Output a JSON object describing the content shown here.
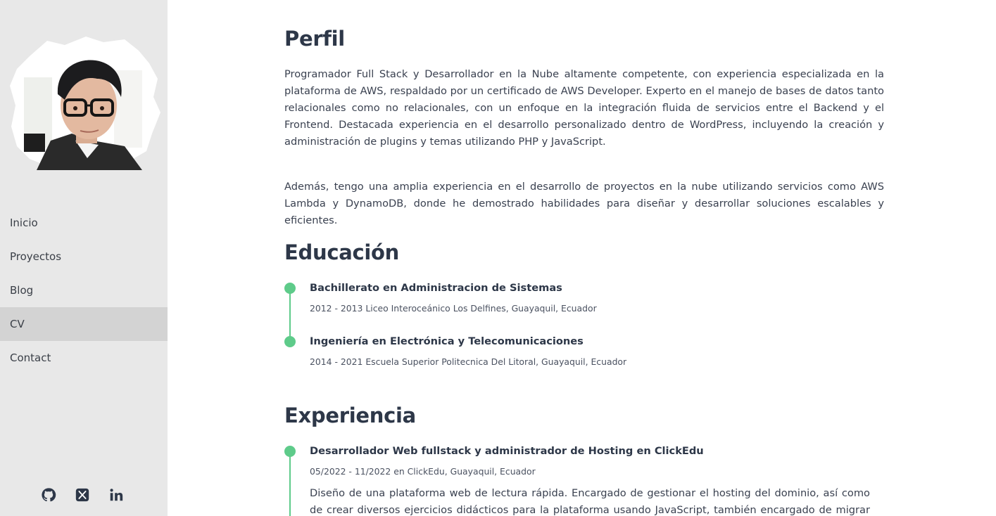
{
  "sidebar": {
    "nav": [
      {
        "label": "Inicio"
      },
      {
        "label": "Proyectos"
      },
      {
        "label": "Blog"
      },
      {
        "label": "CV",
        "active": true
      },
      {
        "label": "Contact"
      }
    ],
    "social_icons": [
      "github-icon",
      "x-twitter-icon",
      "linkedin-icon"
    ]
  },
  "perfil": {
    "title": "Perfil",
    "p1": "Programador Full Stack y Desarrollador en la Nube altamente competente, con experiencia especializada en la plataforma de AWS, respaldado por un certificado de AWS Developer. Experto en el manejo de bases de datos tanto relacionales como no relacionales, con un enfoque en la integración fluida de servicios entre el Backend y el Frontend. Destacada experiencia en el desarrollo personalizado dentro de WordPress, incluyendo la creación y administración de plugins y temas utilizando PHP y JavaScript.",
    "p2": "Además, tengo una amplia experiencia en el desarrollo de proyectos en la nube utilizando servicios como AWS Lambda y DynamoDB, donde he demostrado habilidades para diseñar y desarrollar soluciones escalables y eficientes."
  },
  "educacion": {
    "title": "Educación",
    "items": [
      {
        "title": "Bachillerato en Administracion de Sistemas",
        "meta": "2012 - 2013 Liceo Interoceánico Los Delfines, Guayaquil, Ecuador"
      },
      {
        "title": "Ingeniería en Electrónica y Telecomunicaciones",
        "meta": "2014 - 2021 Escuela Superior Politecnica Del Litoral, Guayaquil, Ecuador"
      }
    ]
  },
  "experiencia": {
    "title": "Experiencia",
    "items": [
      {
        "title": "Desarrollador Web fullstack y administrador de Hosting en ClickEdu",
        "meta": "05/2022 - 11/2022 en ClickEdu, Guayaquil, Ecuador",
        "desc": "Diseño de una plataforma web de lectura rápida. Encargado de gestionar el hosting del dominio, así como de crear diversos ejercicios didácticos para la plataforma usando JavaScript, también encargado de migrar algunas"
      }
    ]
  },
  "colors": {
    "accent": "#5ecb8a",
    "sidebar_bg": "#e8e8e8",
    "nav_active_bg": "#d3d3d3",
    "text": "#2d3748"
  }
}
